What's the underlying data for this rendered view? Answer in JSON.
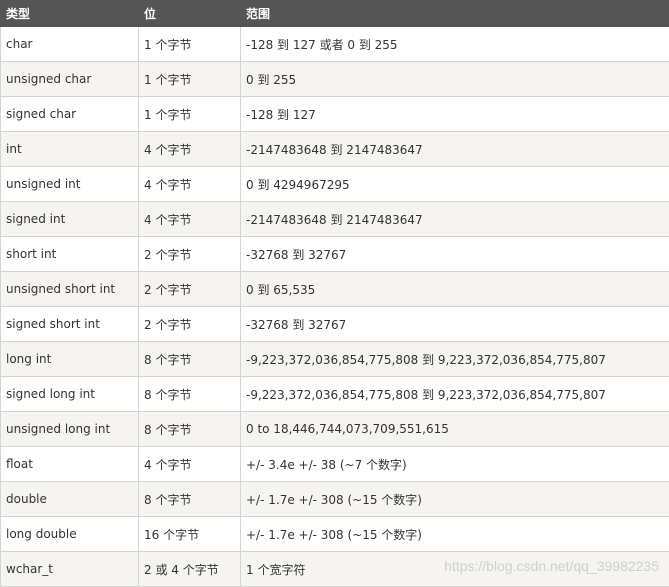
{
  "table": {
    "headers": [
      "类型",
      "位",
      "范围"
    ],
    "rows": [
      [
        "char",
        "1 个字节",
        "-128 到 127 或者 0 到 255"
      ],
      [
        "unsigned char",
        "1 个字节",
        "0 到 255"
      ],
      [
        "signed char",
        "1 个字节",
        "-128 到 127"
      ],
      [
        "int",
        "4 个字节",
        "-2147483648 到 2147483647"
      ],
      [
        "unsigned int",
        "4 个字节",
        "0 到 4294967295"
      ],
      [
        "signed int",
        "4 个字节",
        "-2147483648 到 2147483647"
      ],
      [
        "short int",
        "2 个字节",
        "-32768 到 32767"
      ],
      [
        "unsigned short int",
        "2 个字节",
        "0 到 65,535"
      ],
      [
        "signed short int",
        "2 个字节",
        "-32768 到 32767"
      ],
      [
        "long int",
        "8 个字节",
        "-9,223,372,036,854,775,808 到 9,223,372,036,854,775,807"
      ],
      [
        "signed long int",
        "8 个字节",
        "-9,223,372,036,854,775,808 到 9,223,372,036,854,775,807"
      ],
      [
        "unsigned long int",
        "8 个字节",
        "0 to 18,446,744,073,709,551,615"
      ],
      [
        "float",
        "4 个字节",
        "+/- 3.4e +/- 38 (~7 个数字)"
      ],
      [
        "double",
        "8 个字节",
        "+/- 1.7e +/- 308 (~15 个数字)"
      ],
      [
        "long double",
        "16 个字节",
        "+/- 1.7e +/- 308 (~15 个数字)"
      ],
      [
        "wchar_t",
        "2 或 4 个字节",
        "1 个宽字符"
      ]
    ]
  },
  "watermark": "https://blog.csdn.net/qq_39982235",
  "colors": {
    "header_bg": "#555555",
    "header_text": "#ffffff",
    "row_alt_bg": "#f6f4f0",
    "border": "#d4d4d4"
  }
}
